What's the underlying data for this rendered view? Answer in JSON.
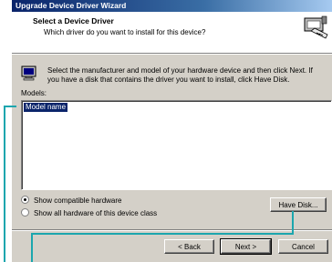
{
  "window": {
    "title": "Upgrade Device Driver Wizard"
  },
  "header": {
    "title": "Select a Device Driver",
    "subtitle": "Which driver do you want to install for this device?",
    "icon": "wizard-hardware-icon"
  },
  "info": {
    "icon": "computer-monitor-icon",
    "text": "Select the manufacturer and model of your hardware device and then click Next. If you have a disk that contains the driver you want to install, click Have Disk."
  },
  "models": {
    "label": "Models:",
    "column_header": "Model name"
  },
  "options": [
    {
      "label": "Show compatible hardware",
      "selected": true
    },
    {
      "label": "Show all hardware of this device class",
      "selected": false
    }
  ],
  "buttons": {
    "have_disk": "Have Disk...",
    "back": "< Back",
    "next": "Next >",
    "cancel": "Cancel"
  },
  "colors": {
    "callout": "#1ba6ae",
    "title_bar": "#0a246a",
    "face": "#d4d0c8"
  }
}
